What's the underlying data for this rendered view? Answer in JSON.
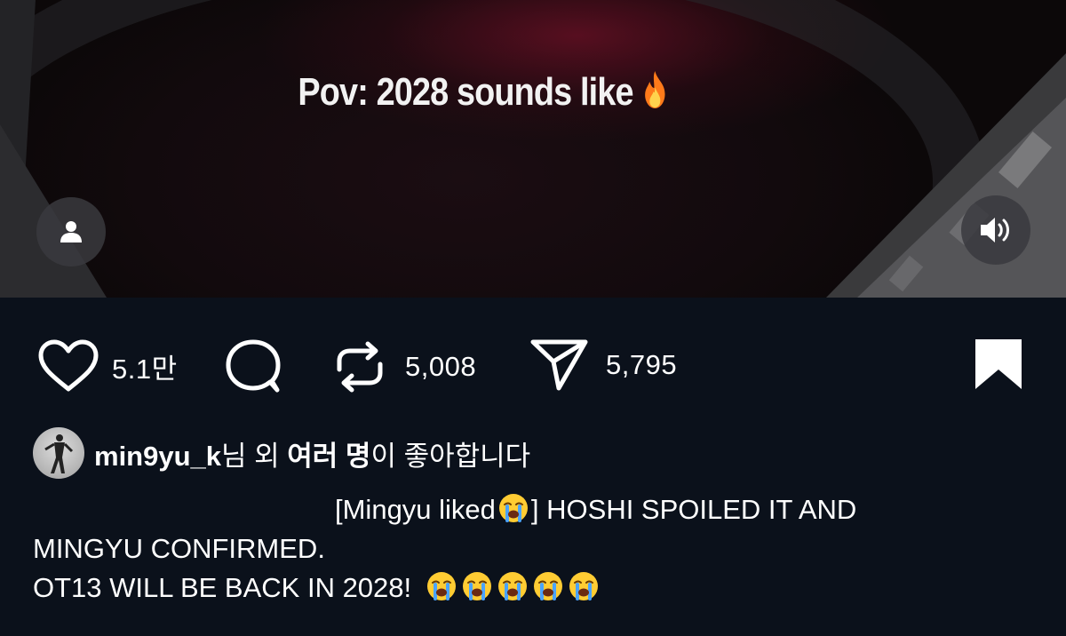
{
  "video": {
    "caption": "Pov: 2028 sounds like",
    "caption_emoji": "fire-emoji",
    "user_button_icon": "user-icon",
    "sound_button_icon": "speaker-icon"
  },
  "actions": {
    "like_count": "5.1만",
    "repost_count": "5,008",
    "share_count": "5,795",
    "bookmark_state": "saved"
  },
  "likes": {
    "username": "min9yu_k",
    "text_mid": "님 외 ",
    "text_strong": "여러 명",
    "text_end": "이 좋아합니다"
  },
  "caption": {
    "part1": "[Mingyu liked",
    "part2": "] HOSHI SPOILED IT AND",
    "line2": "MINGYU CONFIRMED.",
    "line3": "OT13 WILL BE BACK IN 2028!",
    "emoji_name": "loudly-crying-face-emoji",
    "trailing_emoji_count": 5
  },
  "colors": {
    "background": "#0b111b",
    "text": "#ffffff",
    "fire_emoji": "#ff8a1f",
    "crying_face": "#ffcc33",
    "tears": "#4aa3ff"
  }
}
